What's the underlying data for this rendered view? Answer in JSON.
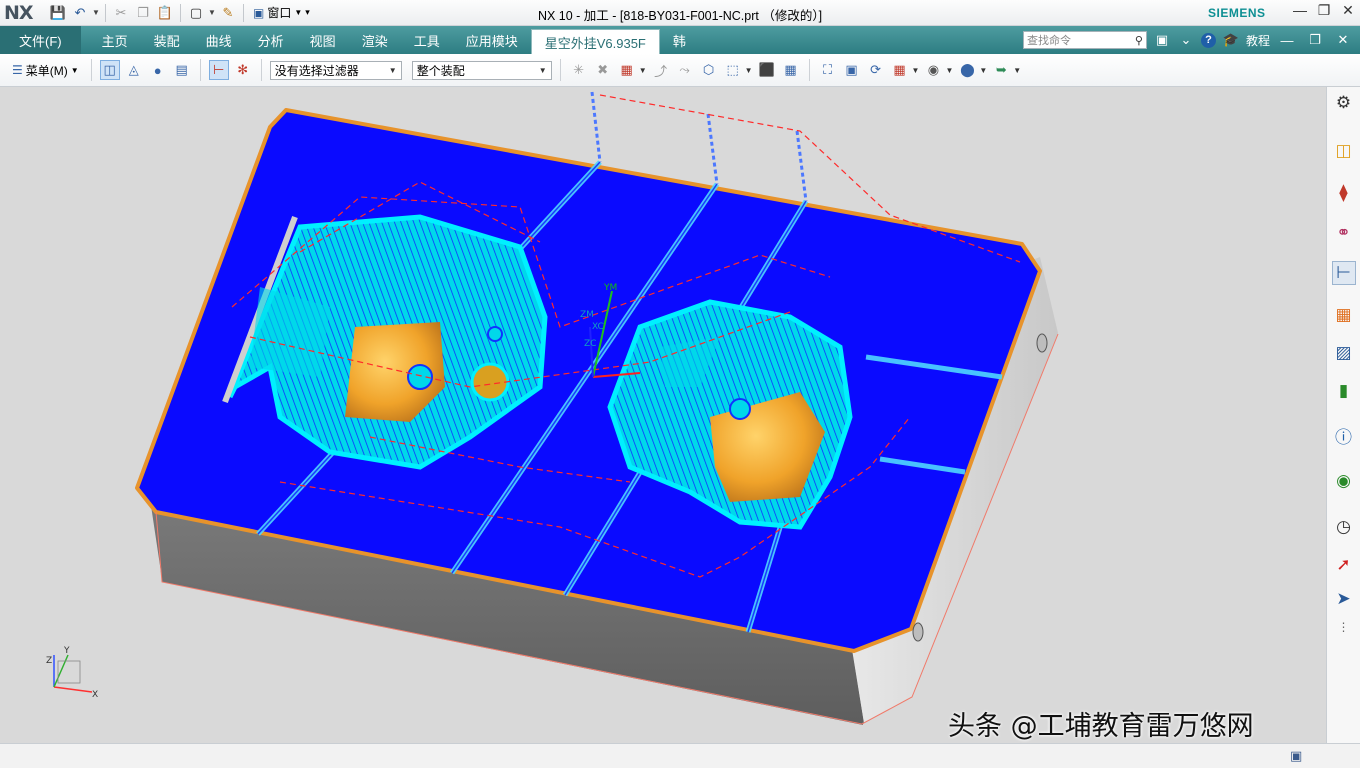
{
  "app": {
    "logo": "NX",
    "window_menu": "窗口",
    "document_title": "NX 10 - 加工 - [818-BY031-F001-NC.prt （修改的）]",
    "brand": "SIEMENS"
  },
  "ribbon": {
    "file_tab": "文件(F)",
    "tabs": [
      "主页",
      "装配",
      "曲线",
      "分析",
      "视图",
      "渲染",
      "工具",
      "应用模块"
    ],
    "active_tab": "星空外挂V6.935F",
    "extra_tab": "韩",
    "search_placeholder": "查找命令",
    "tutorial": "教程"
  },
  "toolbar": {
    "menu_label": "菜单(M)",
    "selection_filter": "没有选择过滤器",
    "assembly_scope": "整个装配"
  },
  "viewport": {
    "triad": {
      "x": "X",
      "y": "Y",
      "z": "Z"
    },
    "wcs_labels": {
      "ym": "YM",
      "zm": "ZM",
      "xc": "XC",
      "zc": "ZC"
    }
  },
  "watermark": "头条 @工埔教育雷万悠网",
  "colors": {
    "ribbon": "#2d7d82",
    "plate_top": "#0a0aff",
    "plate_side": "#6f6f6f",
    "plate_edge": "#e7932c",
    "cavity": "#00e5ee",
    "core_surface": "#f0a32a",
    "toolpath": "#ff2a2a"
  }
}
